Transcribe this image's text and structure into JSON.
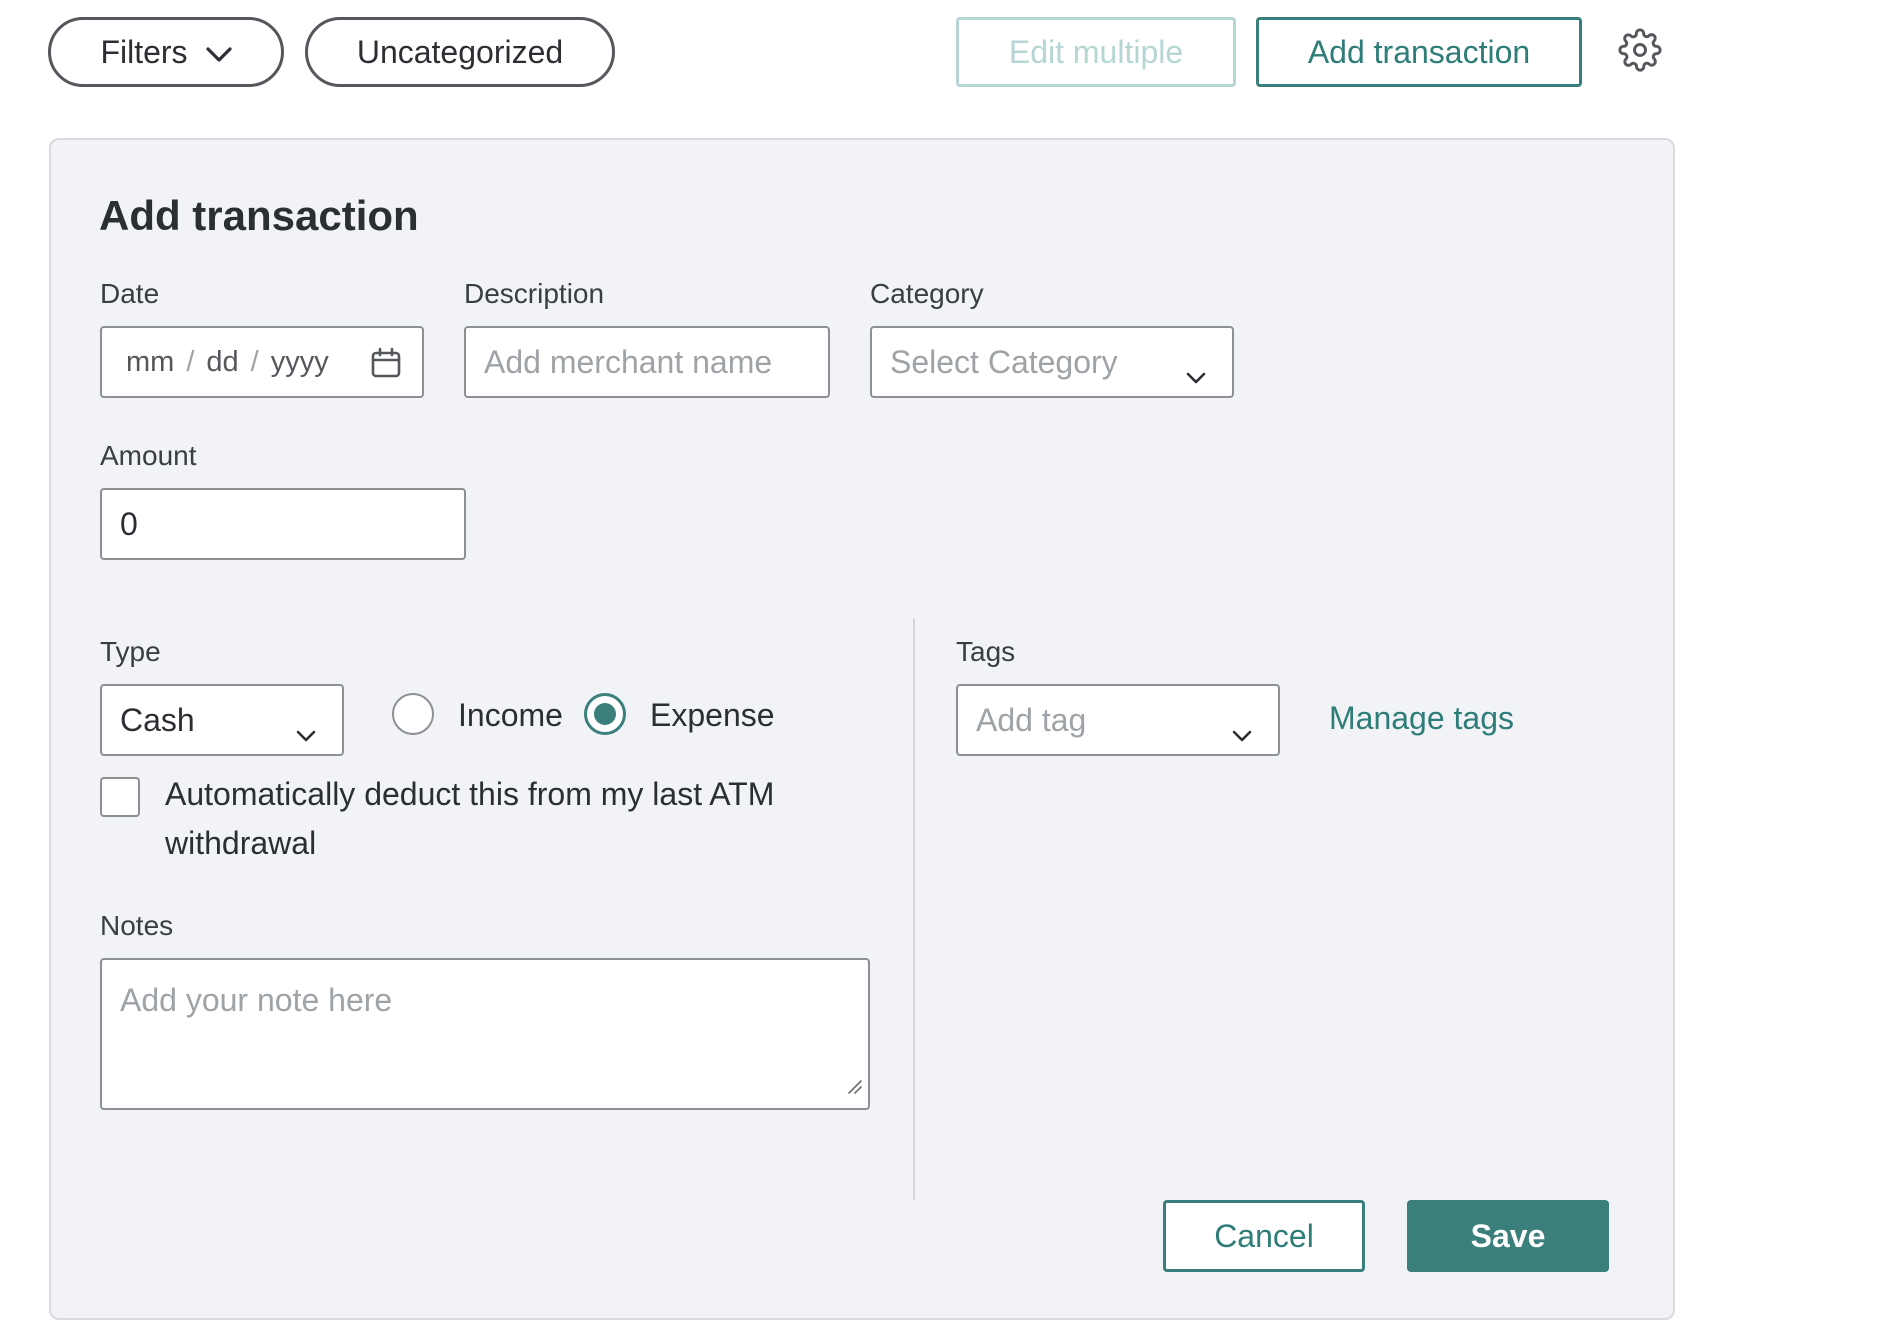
{
  "toolbar": {
    "filters_label": "Filters",
    "uncategorized_label": "Uncategorized",
    "edit_multiple_label": "Edit multiple",
    "add_transaction_label": "Add transaction"
  },
  "form": {
    "title": "Add transaction",
    "date": {
      "label": "Date",
      "placeholder_month": "mm",
      "placeholder_day": "dd",
      "placeholder_year": "yyyy",
      "separator": "/"
    },
    "description": {
      "label": "Description",
      "placeholder": "Add merchant name"
    },
    "category": {
      "label": "Category",
      "placeholder": "Select Category"
    },
    "amount": {
      "label": "Amount",
      "value": "0"
    },
    "type": {
      "label": "Type",
      "selected": "Cash",
      "radio_income": "Income",
      "radio_expense": "Expense",
      "selected_radio": "Expense"
    },
    "auto_deduct": {
      "label": "Automatically deduct this from my last ATM withdrawal",
      "checked": false
    },
    "notes": {
      "label": "Notes",
      "placeholder": "Add your note here"
    },
    "tags": {
      "label": "Tags",
      "placeholder": "Add tag",
      "manage_label": "Manage tags"
    },
    "cancel_label": "Cancel",
    "save_label": "Save"
  },
  "colors": {
    "accent": "#3a7f7b",
    "accent_disabled": "#b6d6d3",
    "panel_bg": "#f2f3f7"
  },
  "icons": {
    "filters": "chevron-down-icon",
    "settings": "gear-icon",
    "date": "calendar-icon",
    "dropdowns": "chevron-down-icon",
    "notes": "resize-handle-icon"
  }
}
